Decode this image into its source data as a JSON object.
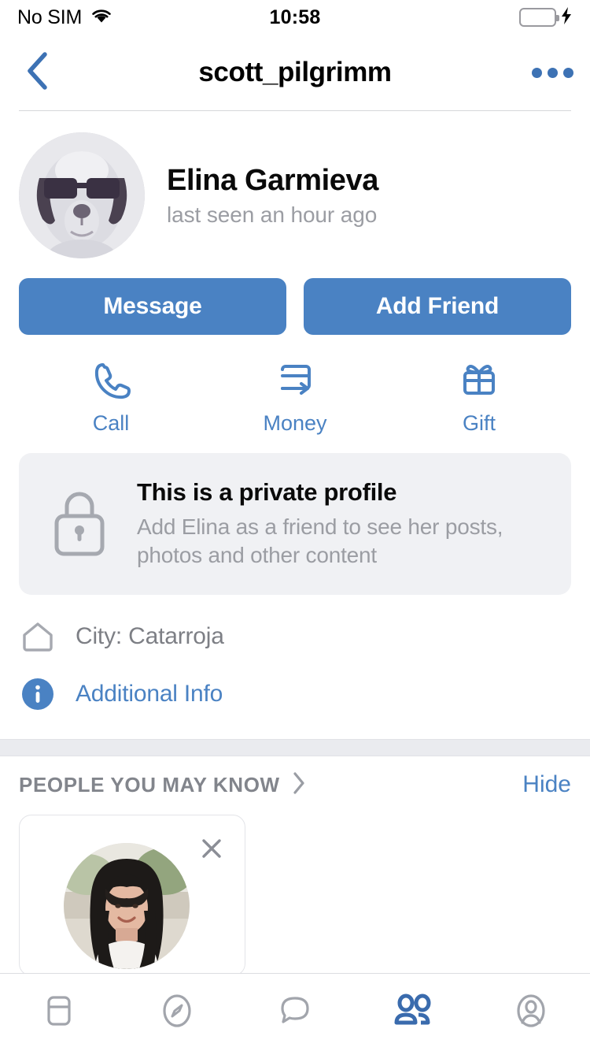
{
  "status_bar": {
    "carrier": "No SIM",
    "time": "10:58",
    "wifi_icon": "wifi-icon",
    "battery_icon": "battery-icon",
    "charging_icon": "charging-bolt-icon",
    "battery_color": "#49da5f"
  },
  "nav": {
    "back_icon": "chevron-left-icon",
    "title": "scott_pilgrimm",
    "more_icon": "more-horizontal-icon",
    "accent_color": "#3d72b4"
  },
  "profile": {
    "avatar_name": "dog-with-sunglasses-avatar",
    "name": "Elina Garmieva",
    "status": "last seen an hour ago"
  },
  "primary_buttons": {
    "message_label": "Message",
    "add_friend_label": "Add Friend",
    "color": "#4a82c3"
  },
  "actions": [
    {
      "icon": "phone-icon",
      "label": "Call"
    },
    {
      "icon": "money-transfer-icon",
      "label": "Money"
    },
    {
      "icon": "gift-icon",
      "label": "Gift"
    }
  ],
  "private_card": {
    "icon": "lock-icon",
    "title": "This is a private profile",
    "description": "Add Elina as a friend to see her posts, photos and other content"
  },
  "info": {
    "city_icon": "home-icon",
    "city_label": "City: Catarroja",
    "additional_icon": "info-circle-icon",
    "additional_label": "Additional Info"
  },
  "people_section": {
    "title": "PEOPLE YOU MAY KNOW",
    "chevron_icon": "chevron-right-icon",
    "hide_label": "Hide",
    "suggestion": {
      "photo_name": "woman-dark-hair-photo",
      "close_icon": "close-icon"
    }
  },
  "tabbar": {
    "items": [
      {
        "icon": "news-feed-icon",
        "active": false
      },
      {
        "icon": "compass-discover-icon",
        "active": false
      },
      {
        "icon": "chat-bubble-icon",
        "active": false
      },
      {
        "icon": "friends-icon",
        "active": true
      },
      {
        "icon": "profile-circle-icon",
        "active": false
      }
    ],
    "active_color": "#3a6bad",
    "inactive_color": "#a2a5ac"
  }
}
